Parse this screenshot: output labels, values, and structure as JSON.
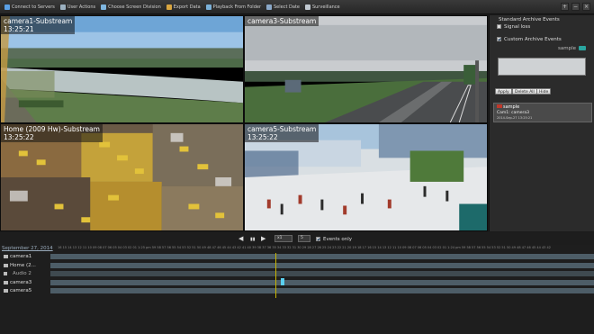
{
  "toolbar": {
    "items": [
      {
        "label": "Connect to Servers",
        "color": "#5aa0e6"
      },
      {
        "label": "User Actions",
        "color": "#9bb0c0"
      },
      {
        "label": "Choose Screen Division",
        "color": "#7eb6e0"
      },
      {
        "label": "Export Data",
        "color": "#d9a640"
      },
      {
        "label": "Playback From Folder",
        "color": "#7ab0d8"
      },
      {
        "label": "Select Date",
        "color": "#8aa8c8"
      },
      {
        "label": "Surveillance",
        "color": "#c0c8d0"
      }
    ],
    "window_controls": [
      "+",
      "−",
      "×"
    ]
  },
  "tiles": [
    {
      "title": "camera1-Substream",
      "time": "13:25:21"
    },
    {
      "title": "camera3-Substream",
      "time": ""
    },
    {
      "title": "Home (2009 Hw)-Substream",
      "time": "13:25:22"
    },
    {
      "title": "camera5-Substream",
      "time": "13:25:22"
    }
  ],
  "panel": {
    "standard_title": "Standard Archive Events",
    "signal_loss": "Signal loss",
    "custom_title": "Custom Archive Events",
    "sample_label": "sample",
    "buttons": {
      "apply": "Apply",
      "delete_all": "Delete All",
      "hide": "Hide"
    },
    "event": {
      "name": "sample",
      "source": "Cam1: camera3",
      "date": "2014-Sep-27 13:25:21"
    }
  },
  "playback": {
    "prev": "◀",
    "pause": "▮▮",
    "next": "▶",
    "speed": "x1",
    "step": "5",
    "events_only": "Events only"
  },
  "timeline": {
    "date": "September 27, 2014",
    "ruler": "16  15  14  13  12  11  10  09  08  07  06  05  04  03  02  01  1:25 pm  59  58  57  56  55  54  53  52  51  50  49  48  47  46  45  44  43  42  41  40  39  38  37  36  35  34  33  32  31  30  29  28  27  26  25  24  23  22  21  20  19  18  17  16  15  14  13  12  11  10  09  08  07  06  05  04  03  02  01  1:24 pm  59  58  57  56  55  54  53  52  51  50  49  48  47  46  45  44  43  42",
    "tracks": [
      "camera1",
      "Home (2...",
      "Audio 2",
      "camera3",
      "camera5"
    ]
  }
}
